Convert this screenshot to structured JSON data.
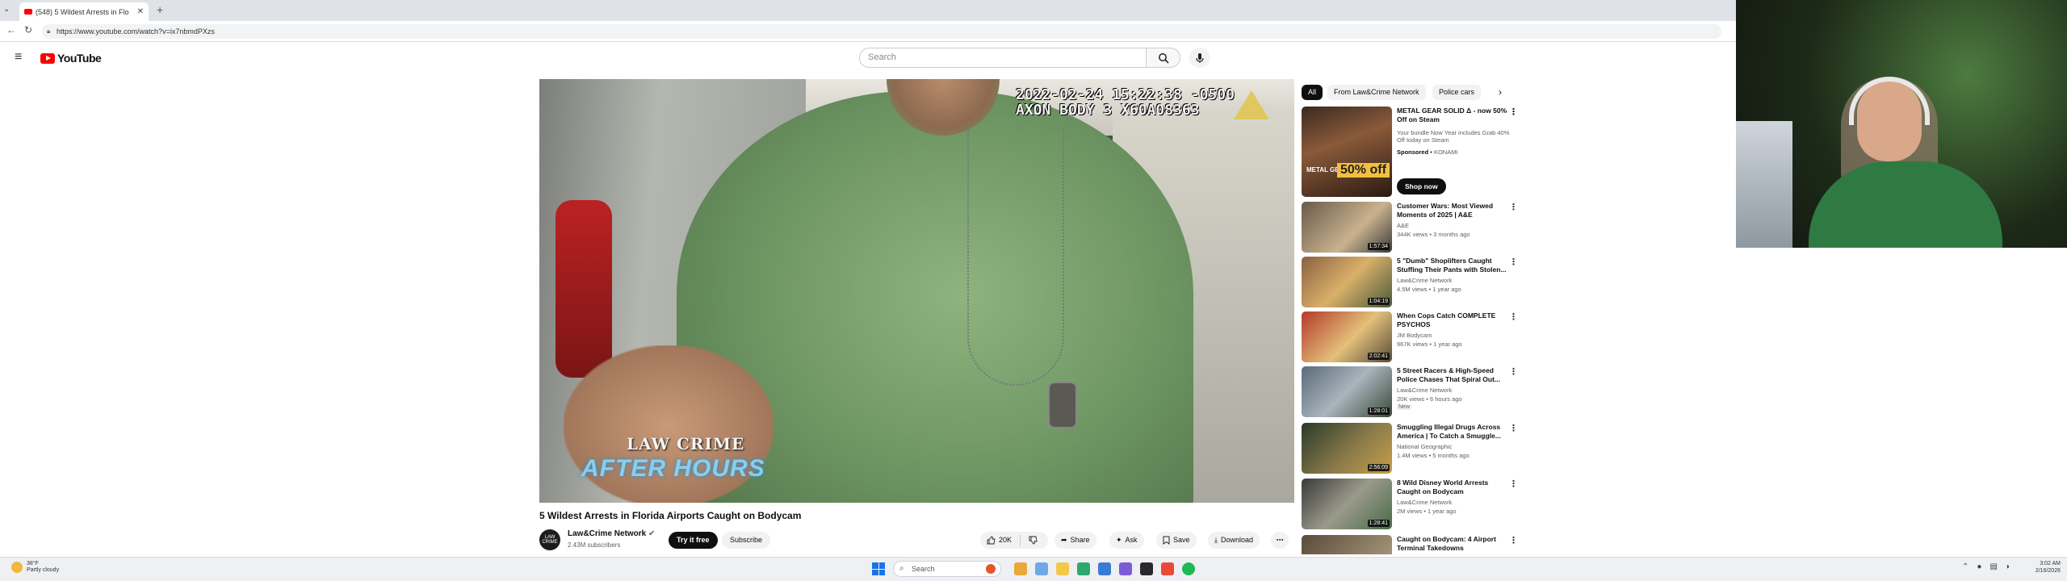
{
  "browser": {
    "tab_title": "(548) 5 Wildest Arrests in Flo",
    "url": "https://www.youtube.com/watch?v=ix7nbmdPXzs"
  },
  "youtube": {
    "logo_text": "YouTube",
    "search_placeholder": "Search"
  },
  "player": {
    "timestamp_line1": "2022-02-24 15:22:38 -0500",
    "timestamp_line2": "AXON BODY 3 X60A08363",
    "watermark_top": "LAW CRIME",
    "watermark_bottom": "AFTER HOURS"
  },
  "video": {
    "title": "5 Wildest Arrests in Florida Airports Caught on Bodycam",
    "channel": "Law&Crime Network",
    "channel_avatar_text": "LAW CRIME",
    "subscribers": "2.43M subscribers",
    "try_free": "Try it free",
    "subscribe": "Subscribe",
    "likes": "20K",
    "share": "Share",
    "ask": "Ask",
    "save": "Save",
    "download": "Download"
  },
  "sidebar": {
    "chips": [
      "All",
      "From Law&Crime Network",
      "Police cars"
    ],
    "ad": {
      "title": "METAL GEAR SOLID Δ - now 50% Off on Steam",
      "description": "Your bundle Now Year includes Grab 40% Off today on Steam",
      "sponsored": "Sponsored",
      "advertiser": "KONAMI",
      "thumb_label": "METAL GEAR SOLID",
      "thumb_offer": "50% off",
      "cta": "Shop now"
    },
    "videos": [
      {
        "title": "Customer Wars: Most Viewed Moments of 2025 | A&E",
        "channel": "A&E",
        "meta": "344K views • 3 months ago",
        "duration": "1:57:34",
        "badge": ""
      },
      {
        "title": "5 \"Dumb\" Shoplifters Caught Stuffing Their Pants with Stolen...",
        "channel": "Law&Crime Network",
        "meta": "4.5M views • 1 year ago",
        "duration": "1:04:19",
        "badge": ""
      },
      {
        "title": "When Cops Catch COMPLETE PSYCHOS",
        "channel": "JM Bodycam",
        "meta": "967K views • 1 year ago",
        "duration": "2:02:41",
        "badge": ""
      },
      {
        "title": "5 Street Racers & High-Speed Police Chases That Spiral Out...",
        "channel": "Law&Crime Network",
        "meta": "20K views • 6 hours ago",
        "duration": "1:28:01",
        "badge": "New"
      },
      {
        "title": "Smuggling Illegal Drugs Across America | To Catch a Smuggle...",
        "channel": "National Geographic",
        "meta": "1.4M views • 5 months ago",
        "duration": "2:56:09",
        "badge": ""
      },
      {
        "title": "8 Wild Disney World Arrests Caught on Bodycam",
        "channel": "Law&Crime Network",
        "meta": "2M views • 1 year ago",
        "duration": "1:28:41",
        "badge": ""
      },
      {
        "title": "Caught on Bodycam: 4 Airport Terminal Takedowns",
        "channel": "",
        "meta": "",
        "duration": "",
        "badge": ""
      }
    ]
  },
  "taskbar": {
    "weather_temp": "38°F",
    "weather_desc": "Partly cloudy",
    "search": "Search",
    "time": "3:02 AM",
    "date": "2/16/2026"
  },
  "colors": {
    "youtube_red": "#ff0000",
    "accent_blue": "#1a73e8",
    "shirt_green": "#6e9663"
  }
}
